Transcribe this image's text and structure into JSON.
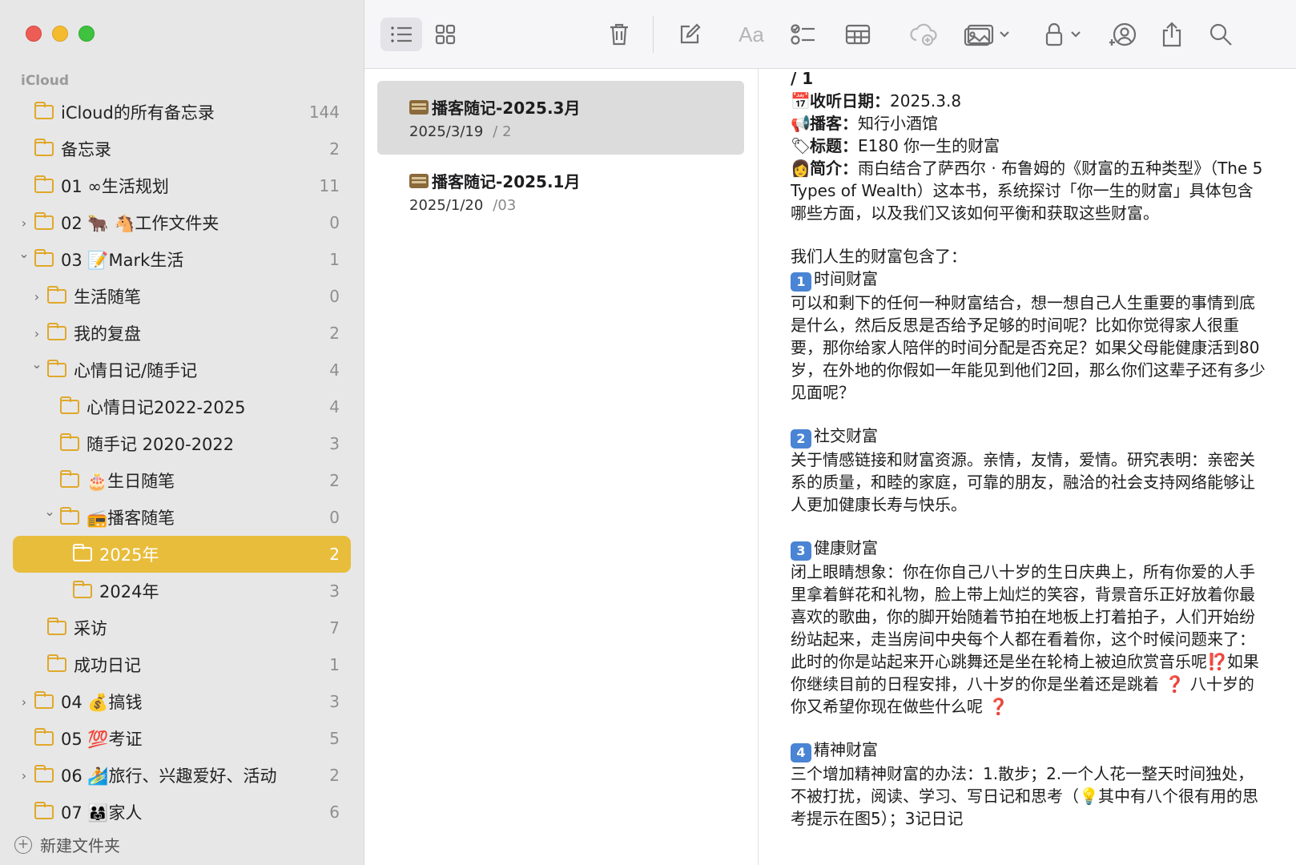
{
  "sidebar": {
    "section": "iCloud",
    "folders": [
      {
        "label": "iCloud的所有备忘录",
        "count": "144",
        "indent": 0,
        "chevron": ""
      },
      {
        "label": "备忘录",
        "count": "2",
        "indent": 0,
        "chevron": ""
      },
      {
        "label": "01 ∞生活规划",
        "count": "11",
        "indent": 0,
        "chevron": ""
      },
      {
        "label": "02 🐂 🐴工作文件夹",
        "count": "0",
        "indent": 0,
        "chevron": "›"
      },
      {
        "label": "03 📝Mark生活",
        "count": "1",
        "indent": 0,
        "chevron": "⌄"
      },
      {
        "label": "生活随笔",
        "count": "0",
        "indent": 1,
        "chevron": "›"
      },
      {
        "label": "我的复盘",
        "count": "2",
        "indent": 1,
        "chevron": "›"
      },
      {
        "label": "心情日记/随手记",
        "count": "4",
        "indent": 1,
        "chevron": "⌄"
      },
      {
        "label": "心情日记2022-2025",
        "count": "4",
        "indent": 2,
        "chevron": ""
      },
      {
        "label": "随手记 2020-2022",
        "count": "3",
        "indent": 2,
        "chevron": ""
      },
      {
        "label": "🎂生日随笔",
        "count": "2",
        "indent": 2,
        "chevron": ""
      },
      {
        "label": "📻播客随笔",
        "count": "0",
        "indent": 2,
        "chevron": "⌄"
      },
      {
        "label": "2025年",
        "count": "2",
        "indent": 3,
        "chevron": "",
        "selected": true
      },
      {
        "label": "2024年",
        "count": "3",
        "indent": 3,
        "chevron": ""
      },
      {
        "label": "采访",
        "count": "7",
        "indent": 1,
        "chevron": ""
      },
      {
        "label": "成功日记",
        "count": "1",
        "indent": 1,
        "chevron": ""
      },
      {
        "label": "04 💰搞钱",
        "count": "3",
        "indent": 0,
        "chevron": "›"
      },
      {
        "label": "05 💯考证",
        "count": "5",
        "indent": 0,
        "chevron": ""
      },
      {
        "label": "06 🏄旅行、兴趣爱好、活动",
        "count": "2",
        "indent": 0,
        "chevron": "›"
      },
      {
        "label": "07 👨‍👩‍👧家人",
        "count": "6",
        "indent": 0,
        "chevron": ""
      }
    ],
    "new_folder": "新建文件夹"
  },
  "toolbar": {
    "font_label": "Aa",
    "icons": [
      "list-view-icon",
      "gallery-view-icon",
      "trash-icon",
      "compose-icon",
      "format-icon",
      "checklist-icon",
      "table-icon",
      "link-icon",
      "media-icon",
      "lock-icon",
      "collaborate-icon",
      "share-icon",
      "search-icon"
    ]
  },
  "notes": [
    {
      "title": "播客随记-2025.3月",
      "date": "2025/3/19",
      "preview": "/ 2"
    },
    {
      "title": "播客随记-2025.1月",
      "date": "2025/1/20",
      "preview": "/03"
    }
  ],
  "content": {
    "top": "/ 1",
    "date_label": "收听日期：",
    "date_value": "2025.3.8",
    "podcast_label": "播客：",
    "podcast_value": "知行小酒馆",
    "title_label": "标题：",
    "title_value": "E180 你一生的财富",
    "intro_label": "简介：",
    "intro_value": "雨白结合了萨西尔 · 布鲁姆的《财富的五种类型》（The 5 Types of Wealth）这本书，系统探讨「你一生的财富」具体包含哪些方面，以及我们又该如何平衡和获取这些财富。",
    "wealth_intro": "我们人生的财富包含了：",
    "s1_num": "1",
    "s1_title": "时间财富",
    "s1_body": "可以和剩下的任何一种财富结合，想一想自己人生重要的事情到底是什么，然后反思是否给予足够的时间呢？比如你觉得家人很重要，那你给家人陪伴的时间分配是否充足？如果父母能健康活到80岁，在外地的你假如一年能见到他们2回，那么你们这辈子还有多少见面呢？",
    "s2_num": "2",
    "s2_title": "社交财富",
    "s2_body": "关于情感链接和财富资源。亲情，友情，爱情。研究表明：亲密关系的质量，和睦的家庭，可靠的朋友，融洽的社会支持网络能够让人更加健康长寿与快乐。",
    "s3_num": "3",
    "s3_title": "健康财富",
    "s3_body": "闭上眼睛想象：你在你自己八十岁的生日庆典上，所有你爱的人手里拿着鲜花和礼物，脸上带上灿烂的笑容，背景音乐正好放着你最喜欢的歌曲，你的脚开始随着节拍在地板上打着拍子，人们开始纷纷站起来，走当房间中央每个人都在看着你，这个时候问题来了：",
    "s3_body2": "此时的你是站起来开心跳舞还是坐在轮椅上被迫欣赏音乐呢",
    "s3_body3": "如果你继续目前的日程安排，八十岁的你是坐着还是跳着",
    "s3_body4": "八十岁的你又希望你现在做些什么呢",
    "s4_num": "4",
    "s4_title": "精神财富",
    "s4_body": "三个增加精神财富的办法：1.散步；2.一个人花一整天时间独处，不被打扰，阅读、学习、写日记和思考（",
    "s4_body2": "其中有八个很有用的思考提示在图5）；3记日记"
  },
  "colors": {
    "accent": "#e8bd3c",
    "sidebar_bg": "#e7e7e7",
    "folder_icon": "#e0a82a"
  }
}
